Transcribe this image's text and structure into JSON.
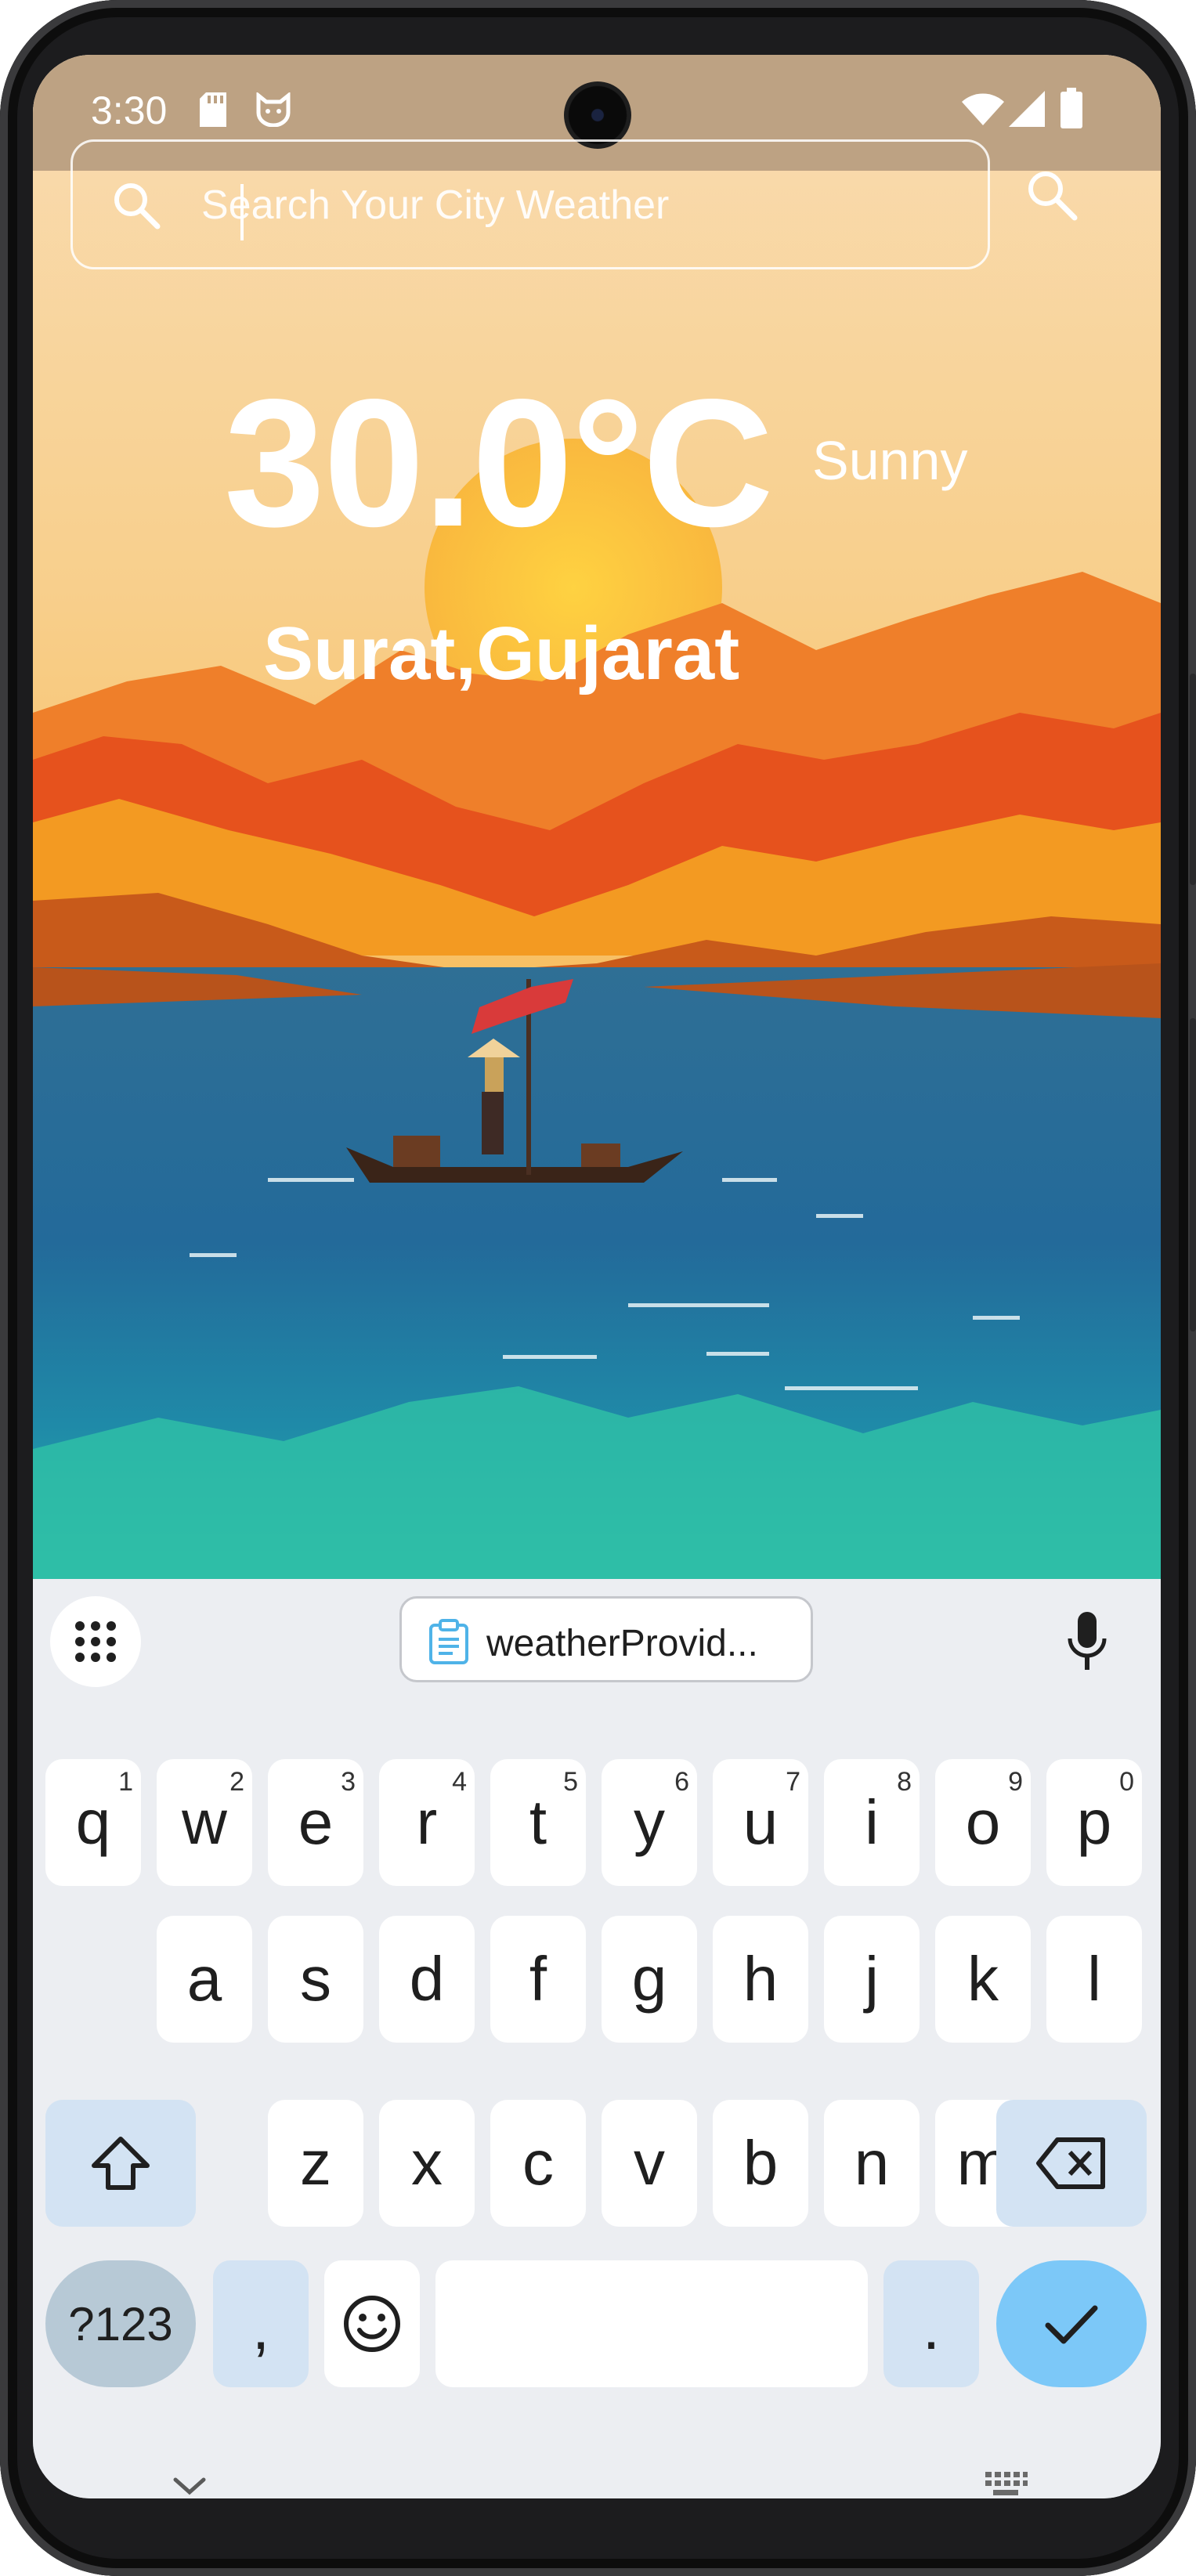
{
  "status_bar": {
    "time": "3:30",
    "icons": [
      "sd-card-icon",
      "cat-icon",
      "wifi-icon",
      "cell-signal-icon",
      "battery-icon"
    ]
  },
  "search": {
    "placeholder": "Search Your City Weather",
    "value": "",
    "icons": [
      "search-icon",
      "search-submit-icon"
    ]
  },
  "weather": {
    "temperature": "30.0°C",
    "condition": "Sunny",
    "location": "Surat,Gujarat"
  },
  "keyboard": {
    "clipboard_suggestion": "weatherProvid...",
    "rows": [
      [
        {
          "label": "q",
          "hint": "1"
        },
        {
          "label": "w",
          "hint": "2"
        },
        {
          "label": "e",
          "hint": "3"
        },
        {
          "label": "r",
          "hint": "4"
        },
        {
          "label": "t",
          "hint": "5"
        },
        {
          "label": "y",
          "hint": "6"
        },
        {
          "label": "u",
          "hint": "7"
        },
        {
          "label": "i",
          "hint": "8"
        },
        {
          "label": "o",
          "hint": "9"
        },
        {
          "label": "p",
          "hint": "0"
        }
      ],
      [
        {
          "label": "a"
        },
        {
          "label": "s"
        },
        {
          "label": "d"
        },
        {
          "label": "f"
        },
        {
          "label": "g"
        },
        {
          "label": "h"
        },
        {
          "label": "j"
        },
        {
          "label": "k"
        },
        {
          "label": "l"
        }
      ],
      [
        {
          "label": "z"
        },
        {
          "label": "x"
        },
        {
          "label": "c"
        },
        {
          "label": "v"
        },
        {
          "label": "b"
        },
        {
          "label": "n"
        },
        {
          "label": "m"
        }
      ]
    ],
    "symbols_label": "?123",
    "comma_label": ",",
    "period_label": ".",
    "icons": [
      "grid-menu-icon",
      "clipboard-icon",
      "mic-icon",
      "shift-icon",
      "backspace-icon",
      "emoji-icon",
      "check-icon",
      "chevron-down-icon",
      "keyboard-switch-icon"
    ]
  },
  "colors": {
    "status_bar_bg": "#bda283",
    "keyboard_bg": "#eceef2",
    "function_key_bg": "#d3e3f3",
    "symbols_key_bg": "#b7c9d6",
    "enter_key_bg": "#7cc8f8",
    "text_on_wallpaper": "#ffffff"
  }
}
